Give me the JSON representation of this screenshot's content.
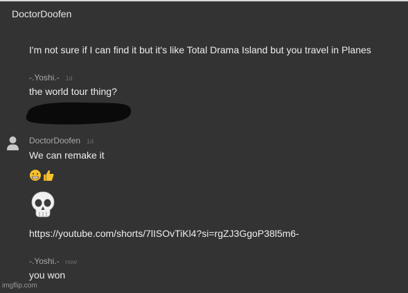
{
  "header": {
    "author": "DoctorDoofen"
  },
  "messages": [
    {
      "text": "I'm not sure if I can find it but it's like Total Drama Island but you travel in Planes"
    },
    {
      "author": "-.Yoshi.-",
      "time": "1d",
      "text": "the world tour thing?"
    },
    {
      "author": "DoctorDoofen",
      "time": "1d",
      "text": "We can remake it",
      "emojis": [
        "grimacing-face",
        "thumbs-up"
      ]
    },
    {
      "emoji": "skull"
    },
    {
      "text": "https://youtube.com/shorts/7lISOvTiKl4?si=rgZJ3GgoP38l5m6-"
    },
    {
      "author": "-.Yoshi.-",
      "time": "now",
      "text": "you won"
    }
  ],
  "watermark": "imgflip.com",
  "colors": {
    "background": "#333333",
    "text": "#eeeeee",
    "username": "#a9a9a9",
    "timestamp": "#6e6e6e"
  }
}
